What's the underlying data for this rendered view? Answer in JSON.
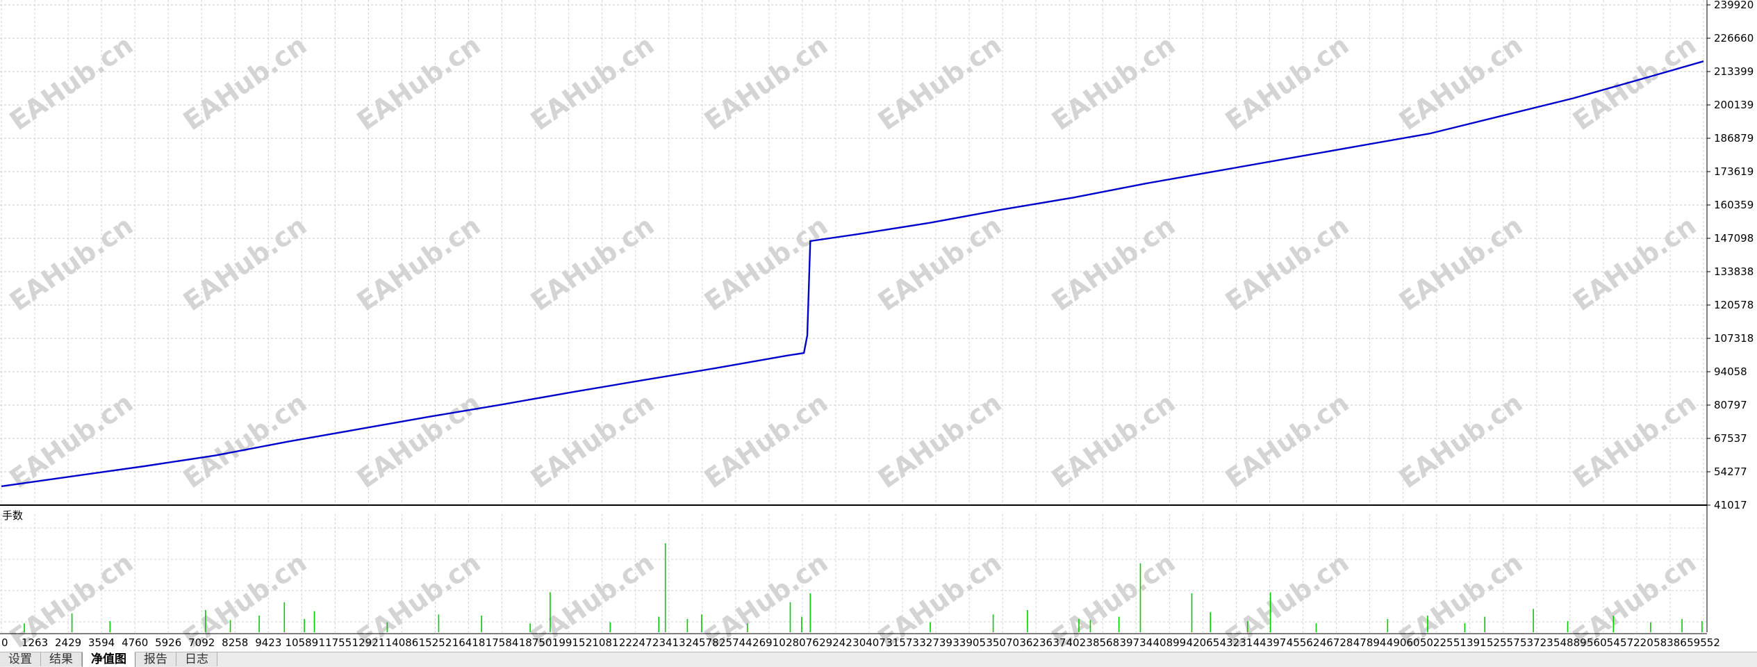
{
  "chart_data": {
    "type": "line",
    "title": "",
    "xlabel": "",
    "ylabel": "",
    "x_tick_labels": [
      "0",
      "1263",
      "2429",
      "3594",
      "4760",
      "5926",
      "7092",
      "8258",
      "9423",
      "10589",
      "11755",
      "12921",
      "14086",
      "15252",
      "16418",
      "17584",
      "18750",
      "19915",
      "21081",
      "22247",
      "23413",
      "24578",
      "25744",
      "26910",
      "28076",
      "29242",
      "30407",
      "31573",
      "32739",
      "33905",
      "35070",
      "36236",
      "37402",
      "38568",
      "39734",
      "40899",
      "42065",
      "43231",
      "44397",
      "45562",
      "46728",
      "47894",
      "49060",
      "50225",
      "51391",
      "52557",
      "53723",
      "54889",
      "56054",
      "57220",
      "58386",
      "59552"
    ],
    "y_tick_labels": [
      "239920",
      "226660",
      "213399",
      "200139",
      "186879",
      "173619",
      "160359",
      "147098",
      "133838",
      "120578",
      "107318",
      "94058",
      "80797",
      "67537",
      "54277",
      "41017"
    ],
    "xlim": [
      0,
      59552
    ],
    "ylim": [
      41017,
      239920
    ],
    "grid": true,
    "series": [
      {
        "color": "#0000cc",
        "x": [
          0,
          2500,
          5000,
          7500,
          10000,
          12500,
          15000,
          17500,
          20000,
          22500,
          25000,
          27500,
          28076,
          28195,
          28300,
          30000,
          32500,
          35000,
          37500,
          40000,
          42500,
          45000,
          47500,
          50000,
          52500,
          55000,
          57500,
          59552
        ],
        "y": [
          48500,
          52500,
          56500,
          60800,
          66200,
          71200,
          76200,
          81000,
          86000,
          90800,
          95500,
          100500,
          101500,
          108500,
          146000,
          148800,
          153300,
          158500,
          163300,
          168800,
          173800,
          178800,
          183800,
          188800,
          195800,
          202800,
          210800,
          217500
        ]
      }
    ],
    "lots_panel": {
      "label": "手数",
      "color": "#00cc00",
      "bars": [
        {
          "x": 804,
          "h": 0.08
        },
        {
          "x": 2470,
          "h": 0.17
        },
        {
          "x": 3800,
          "h": 0.1
        },
        {
          "x": 7142,
          "h": 0.2
        },
        {
          "x": 8010,
          "h": 0.11
        },
        {
          "x": 9020,
          "h": 0.15
        },
        {
          "x": 9900,
          "h": 0.27
        },
        {
          "x": 10600,
          "h": 0.12
        },
        {
          "x": 10950,
          "h": 0.19
        },
        {
          "x": 13500,
          "h": 0.09
        },
        {
          "x": 15300,
          "h": 0.16
        },
        {
          "x": 16800,
          "h": 0.15
        },
        {
          "x": 18500,
          "h": 0.08
        },
        {
          "x": 19200,
          "h": 0.36
        },
        {
          "x": 21300,
          "h": 0.09
        },
        {
          "x": 23000,
          "h": 0.14
        },
        {
          "x": 23230,
          "h": 0.8
        },
        {
          "x": 24000,
          "h": 0.12
        },
        {
          "x": 24500,
          "h": 0.16
        },
        {
          "x": 26100,
          "h": 0.08
        },
        {
          "x": 27600,
          "h": 0.27
        },
        {
          "x": 28000,
          "h": 0.14
        },
        {
          "x": 28300,
          "h": 0.35
        },
        {
          "x": 32500,
          "h": 0.09
        },
        {
          "x": 34700,
          "h": 0.16
        },
        {
          "x": 35900,
          "h": 0.2
        },
        {
          "x": 37700,
          "h": 0.12
        },
        {
          "x": 38100,
          "h": 0.11
        },
        {
          "x": 39100,
          "h": 0.14
        },
        {
          "x": 39850,
          "h": 0.62
        },
        {
          "x": 41650,
          "h": 0.35
        },
        {
          "x": 42300,
          "h": 0.18
        },
        {
          "x": 43600,
          "h": 0.1
        },
        {
          "x": 44400,
          "h": 0.36
        },
        {
          "x": 46000,
          "h": 0.08
        },
        {
          "x": 48500,
          "h": 0.12
        },
        {
          "x": 49900,
          "h": 0.15
        },
        {
          "x": 51200,
          "h": 0.08
        },
        {
          "x": 51900,
          "h": 0.14
        },
        {
          "x": 53600,
          "h": 0.21
        },
        {
          "x": 54800,
          "h": 0.1
        },
        {
          "x": 56400,
          "h": 0.15
        },
        {
          "x": 57700,
          "h": 0.09
        },
        {
          "x": 58800,
          "h": 0.12
        },
        {
          "x": 59500,
          "h": 0.1
        }
      ]
    }
  },
  "watermark": "EAHub.cn",
  "tabs": [
    {
      "label": "设置",
      "active": false
    },
    {
      "label": "结果",
      "active": false
    },
    {
      "label": "净值图",
      "active": true
    },
    {
      "label": "报告",
      "active": false
    },
    {
      "label": "日志",
      "active": false
    }
  ]
}
